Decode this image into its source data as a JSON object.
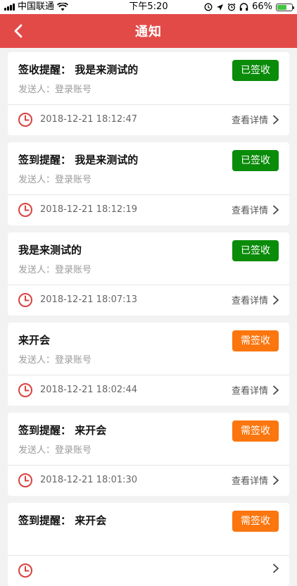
{
  "status_bar": {
    "carrier": "中国联通",
    "time": "下午5:20",
    "battery_text": "66%",
    "battery_level": 0.66,
    "icons": [
      "signal-icon",
      "wifi-icon",
      "location-lock-icon",
      "location-arrow-icon",
      "alarm-icon",
      "headphones-icon",
      "battery-icon"
    ]
  },
  "nav": {
    "title": "通知",
    "back_icon": "chevron-left-icon"
  },
  "colors": {
    "nav_bg": "#e24a48",
    "signed_badge": "#0a8c0a",
    "need_badge": "#fb760e",
    "clock": "#d9423f"
  },
  "notifications": [
    {
      "title": "签收提醒： 我是来测试的",
      "sender": "发送人：登录账号",
      "badge": "已签收",
      "badge_state": "signed",
      "time": "2018-12-21 18:12:47",
      "detail": "查看详情"
    },
    {
      "title": "签到提醒： 我是来测试的",
      "sender": "发送人：登录账号",
      "badge": "已签收",
      "badge_state": "signed",
      "time": "2018-12-21 18:12:19",
      "detail": "查看详情"
    },
    {
      "title": "我是来测试的",
      "sender": "发送人：登录账号",
      "badge": "已签收",
      "badge_state": "signed",
      "time": "2018-12-21 18:07:13",
      "detail": "查看详情"
    },
    {
      "title": "来开会",
      "sender": "发送人：登录账号",
      "badge": "需签收",
      "badge_state": "need",
      "time": "2018-12-21 18:02:44",
      "detail": "查看详情"
    },
    {
      "title": "签到提醒： 来开会",
      "sender": "发送人：登录账号",
      "badge": "需签收",
      "badge_state": "need",
      "time": "2018-12-21 18:01:30",
      "detail": "查看详情"
    },
    {
      "title": "签到提醒： 来开会",
      "sender": "",
      "badge": "需签收",
      "badge_state": "need",
      "time": "",
      "detail": ""
    }
  ]
}
